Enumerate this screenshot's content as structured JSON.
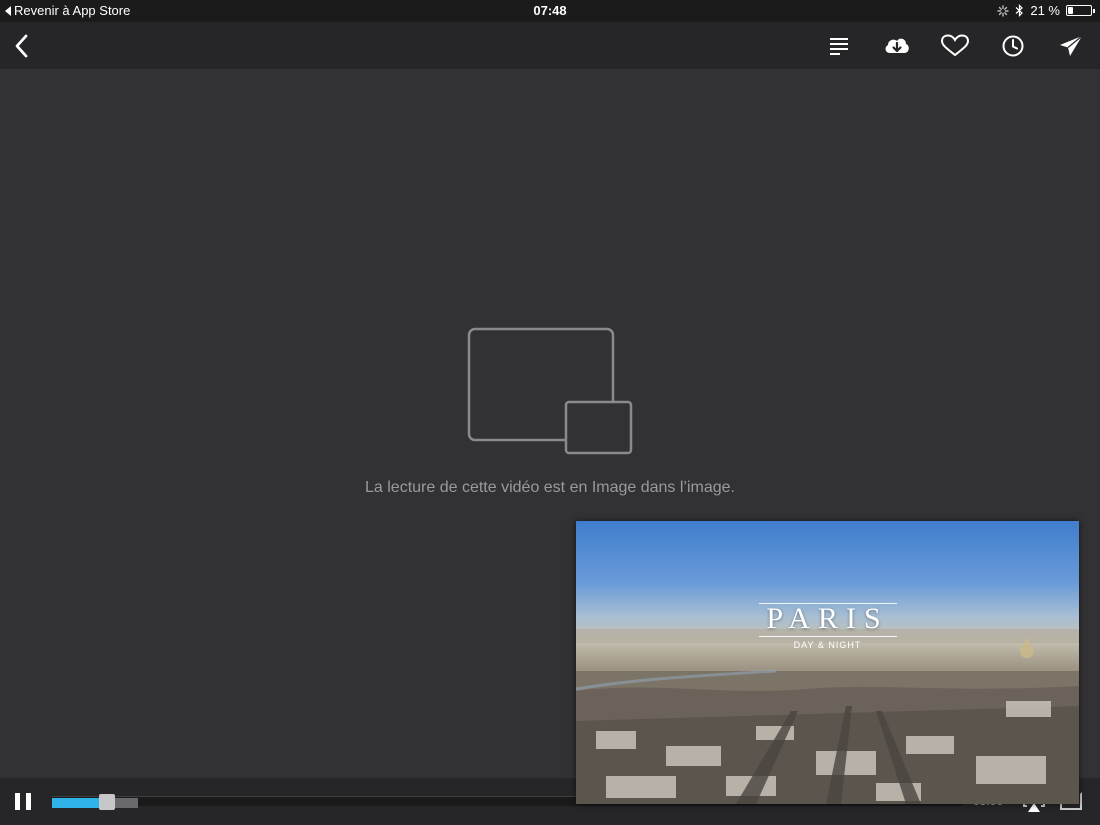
{
  "status_bar": {
    "back_label": "Revenir à App Store",
    "time": "07:48",
    "battery_text": "21 %",
    "battery_level": 0.21
  },
  "nav_bar": {
    "buttons": [
      "back-icon",
      "list-icon",
      "cloud-download-icon",
      "heart-icon",
      "clock-icon",
      "send-icon"
    ]
  },
  "main": {
    "pip_message": "La lecture de cette vidéo est en Image dans l’image."
  },
  "pip_video": {
    "title": "PARIS",
    "subtitle": "DAY & NIGHT"
  },
  "player": {
    "progress_played": 0.06,
    "progress_buffered": 0.094,
    "time_remaining": "05:00"
  },
  "colors": {
    "background": "#323234",
    "bar": "#262628",
    "accent": "#2fb3e8"
  }
}
